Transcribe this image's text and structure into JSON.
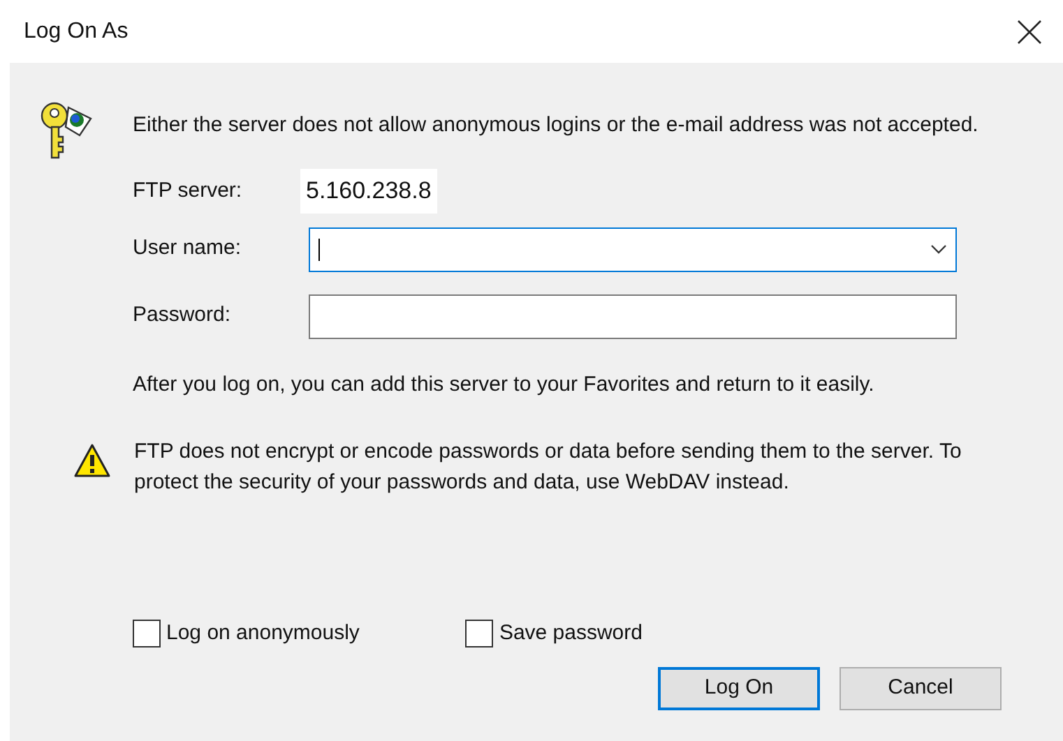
{
  "window": {
    "title": "Log On As"
  },
  "message": "Either the server does not allow anonymous logins or the e-mail address was not accepted.",
  "ftp_server": {
    "label": "FTP server:",
    "value": "5.160.238.8"
  },
  "fields": [
    {
      "kind": "combo",
      "label": "User name:",
      "focused": true
    },
    {
      "kind": "text",
      "label": "Password:",
      "focused": false
    }
  ],
  "info": "After you log on, you can add this server to your Favorites and return to it easily.",
  "warning": "FTP does not encrypt or encode passwords or data before sending them to the server.  To protect the security of your passwords and data, use WebDAV instead.",
  "checkboxes": [
    {
      "label": "Log on anonymously",
      "checked": false
    },
    {
      "label": "Save password",
      "checked": false
    }
  ],
  "buttons": [
    {
      "label": "Log On",
      "default": true
    },
    {
      "label": "Cancel",
      "default": false
    }
  ]
}
